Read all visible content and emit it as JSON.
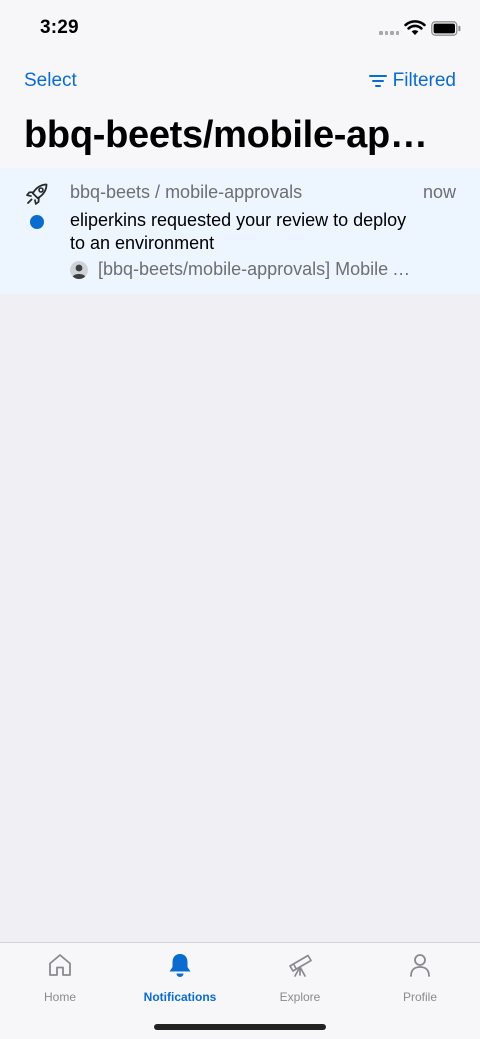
{
  "status_bar": {
    "time": "3:29"
  },
  "header": {
    "select_label": "Select",
    "filter_label": "Filtered",
    "title": "bbq-beets/mobile-approvals"
  },
  "notification": {
    "icon": "rocket-icon",
    "repo": "bbq-beets / mobile-approvals",
    "time": "now",
    "message": "eliperkins requested your review to deploy to an environment",
    "subtitle": "[bbq-beets/mobile-approvals] Mobile Approvals Workflow",
    "unread": true
  },
  "tab_bar": {
    "tabs": [
      {
        "label": "Home",
        "icon": "home-icon",
        "active": false
      },
      {
        "label": "Notifications",
        "icon": "bell-icon",
        "active": true
      },
      {
        "label": "Explore",
        "icon": "telescope-icon",
        "active": false
      },
      {
        "label": "Profile",
        "icon": "person-icon",
        "active": false
      }
    ]
  },
  "colors": {
    "accent": "#0a6ccf",
    "unread_background": "#edf5fe",
    "background": "#efeff4",
    "secondary_text": "#6e6e73"
  }
}
